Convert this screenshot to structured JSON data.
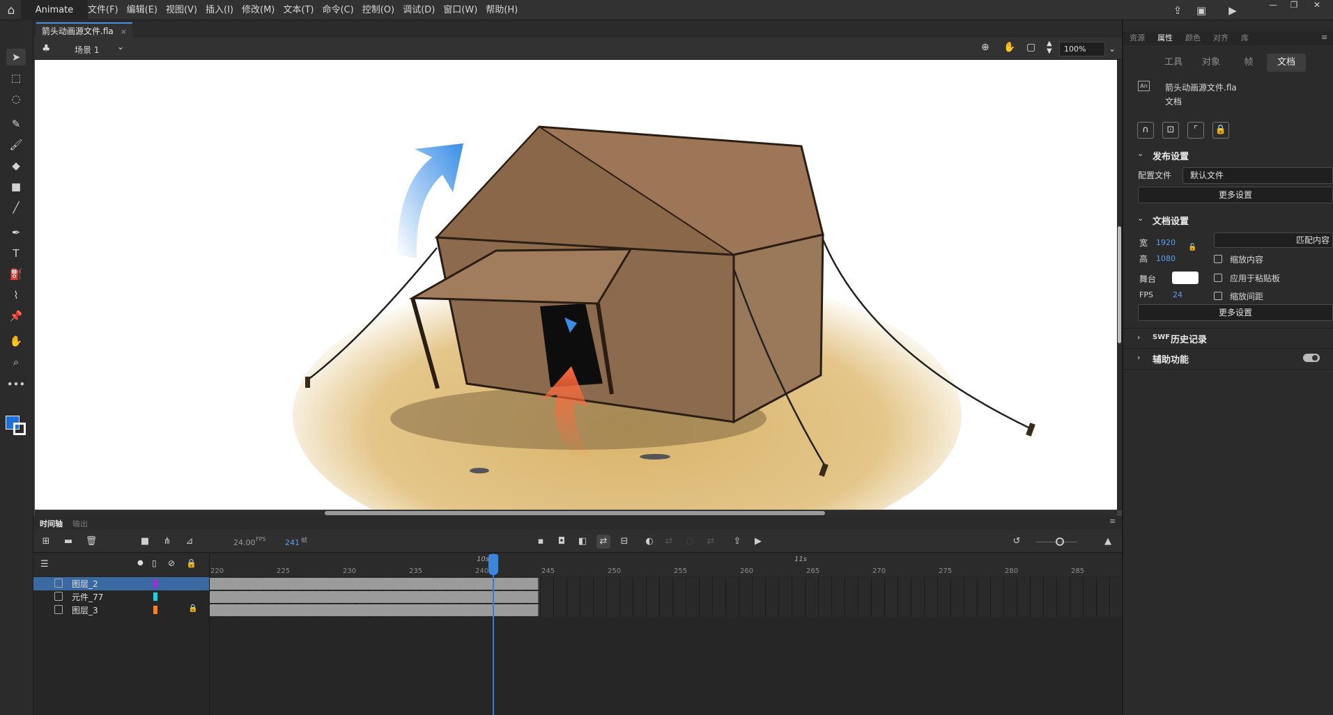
{
  "app": {
    "name": "Animate"
  },
  "menu": [
    "文件(F)",
    "编辑(E)",
    "视图(V)",
    "插入(I)",
    "修改(M)",
    "文本(T)",
    "命令(C)",
    "控制(O)",
    "调试(D)",
    "窗口(W)",
    "帮助(H)"
  ],
  "document": {
    "tab_label": "箭头动画源文件.fla",
    "close": "×"
  },
  "scene": {
    "label": "场景 1",
    "zoom": "100%"
  },
  "timeline": {
    "tab_label": "时间轴",
    "output_label": "输出",
    "fps": "24.00",
    "fps_unit": "FPS",
    "frame": "241",
    "frame_unit": "帧",
    "time_marks": [
      "10s",
      "11s"
    ],
    "ruler": [
      "220",
      "225",
      "230",
      "235",
      "240",
      "245",
      "250",
      "255",
      "260",
      "265",
      "270",
      "275",
      "280",
      "285"
    ],
    "layers": [
      {
        "name": "图层_2",
        "color": "#9b30d9",
        "locked": false,
        "selected": true
      },
      {
        "name": "元件_77",
        "color": "#19d3e6",
        "locked": false,
        "selected": false
      },
      {
        "name": "图层_3",
        "color": "#ff7f1a",
        "locked": true,
        "selected": false
      }
    ]
  },
  "panel": {
    "tabs": [
      "资源",
      "属性",
      "颜色",
      "对齐",
      "库"
    ],
    "active_tab": "属性",
    "subtabs": [
      "工具",
      "对象",
      "帧",
      "文档"
    ],
    "active_subtab": "文档",
    "doc_name": "箭头动画源文件.fla",
    "doc_type": "文档",
    "publish": {
      "title": "发布设置",
      "profile_label": "配置文件",
      "profile_value": "默认文件",
      "more": "更多设置"
    },
    "docsettings": {
      "title": "文档设置",
      "width_label": "宽",
      "width": "1920",
      "height_label": "高",
      "height": "1080",
      "match_button": "匹配内容",
      "scale_content": "缩放内容",
      "stage_label": "舞台",
      "stage_color": "#ffffff",
      "apply_paste": "应用于粘贴板",
      "fps_label": "FPS",
      "fps": "24",
      "scale_spacing": "缩放间距",
      "more": "更多设置"
    },
    "swf_prefix": "SWF",
    "swf_title": "历史记录",
    "accessibility": "辅助功能"
  },
  "colors": {
    "stroke": "#ffffff",
    "fill": "#1e6fd9",
    "playhead": "#2f7fd6",
    "arrow_blue": "#3a8ee6",
    "arrow_orange": "#ff6a3d"
  }
}
